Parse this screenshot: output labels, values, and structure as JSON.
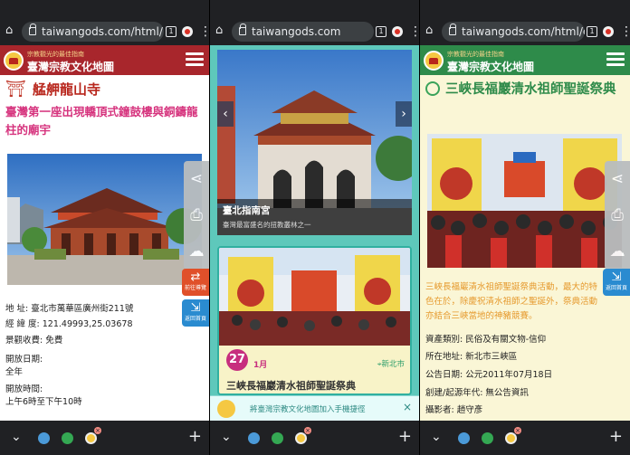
{
  "panels": [
    {
      "url": "taiwangods.com/html/la",
      "tab_count": "1",
      "site_name": "臺灣宗教文化地圖",
      "site_tagline": "宗教觀光的最佳指南",
      "title": "艋舺龍山寺",
      "subtitle": "臺灣第一座出現轎頂式鐘鼓樓與銅鑄龍柱的廟宇",
      "side_tags": [
        {
          "label": "前往導覽"
        },
        {
          "label": "返回首頁"
        }
      ],
      "info": {
        "address": "地  址:  臺北市萬華區廣州街211號",
        "coords": "經 緯 度:  121.49993,25.03678",
        "fee": "景觀收費:  免費",
        "open_date_label": "開放日期:",
        "open_date_value": "全年",
        "open_time_label": "開放時間:",
        "open_time_value": "上午6時至下午10時"
      }
    },
    {
      "url": "taiwangods.com",
      "tab_count": "1",
      "carousel_title": "臺北指南宮",
      "carousel_subtitle": "臺灣最富盛名的扭教叢林之一",
      "event": {
        "day": "27",
        "month": "1月",
        "location": "新北市",
        "title": "三峽長福巖清水祖師聖誕祭典"
      },
      "banner_text": "將臺灣宗教文化地圖加入手機捷徑"
    },
    {
      "url": "taiwangods.com/html/c",
      "tab_count": "1",
      "site_name": "臺灣宗教文化地圖",
      "site_tagline": "宗教觀光的最佳指南",
      "title": "三峽長福巖清水祖師聖誕祭典",
      "side_tag": "返回首頁",
      "description": "三峽長福巖清水祖師聖誕祭典活動，最大的特色在於，除慶祝清水祖師之聖誕外，祭典活動亦結合三峽當地的神豬競賽。",
      "info": {
        "category": "資產類別:  民俗及有關文物-信仰",
        "location": "所在地址:  新北市三峽區",
        "date": "公告日期:  公元2011年07月18日",
        "reason": "創建/起源年代:  無公告資訊",
        "photographer": "攝影者:  趙守彥"
      }
    }
  ],
  "colors": {
    "header_red": "#a8262c",
    "header_green": "#2e8b4a",
    "title_red": "#b8261c",
    "subtitle_pink": "#d6347e",
    "teal": "#30b0a0",
    "orange_text": "#e69a2e"
  }
}
